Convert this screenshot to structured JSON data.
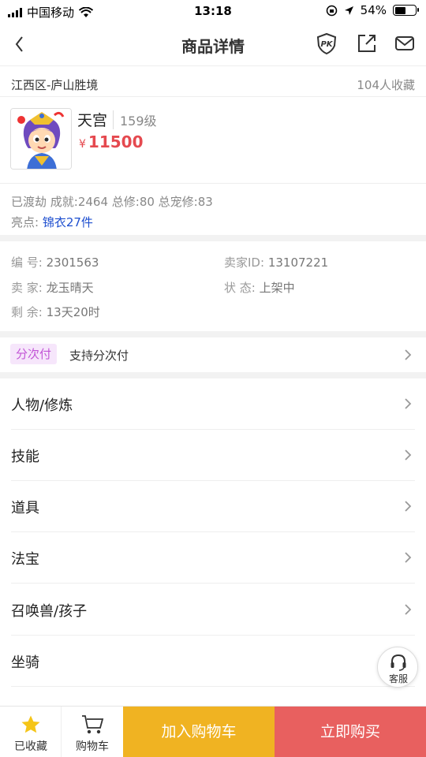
{
  "status_bar": {
    "carrier": "中国移动",
    "time": "13:18",
    "battery_percent": "54%",
    "battery_level": 0.54
  },
  "nav": {
    "title": "商品详情"
  },
  "server": {
    "name": "江西区-庐山胜境",
    "favorites": "104人收藏"
  },
  "role": {
    "name": "天宫",
    "level": "159级",
    "currency": "¥",
    "price": "11500"
  },
  "stats": {
    "text": "已渡劫 成就:2464 总修:80 总宠修:83"
  },
  "highlight": {
    "label": "亮点:",
    "value": "锦衣27件"
  },
  "info": {
    "id_label": "编 号:",
    "id_value": "2301563",
    "seller_id_label": "卖家ID:",
    "seller_id_value": "13107221",
    "seller_label": "卖 家:",
    "seller_value": "龙玉晴天",
    "state_label": "状 态:",
    "state_value": "上架中",
    "remain_label": "剩 余:",
    "remain_value": "13天20时"
  },
  "installment": {
    "tag": "分次付",
    "text": "支持分次付"
  },
  "menu": [
    {
      "label": "人物/修炼"
    },
    {
      "label": "技能"
    },
    {
      "label": "道具"
    },
    {
      "label": "法宝"
    },
    {
      "label": "召唤兽/孩子"
    },
    {
      "label": "坐骑"
    }
  ],
  "customer_service": {
    "label": "客服"
  },
  "bottom": {
    "fav_label": "已收藏",
    "cart_label": "购物车",
    "add_cart": "加入购物车",
    "buy_now": "立即购买"
  },
  "colors": {
    "price": "#e5494f",
    "highlight": "#1d4ecf",
    "add_cart_bg": "#f0b322",
    "buy_bg": "#e8605f",
    "tag_bg": "#f6e6fb",
    "tag_text": "#c255d6"
  }
}
